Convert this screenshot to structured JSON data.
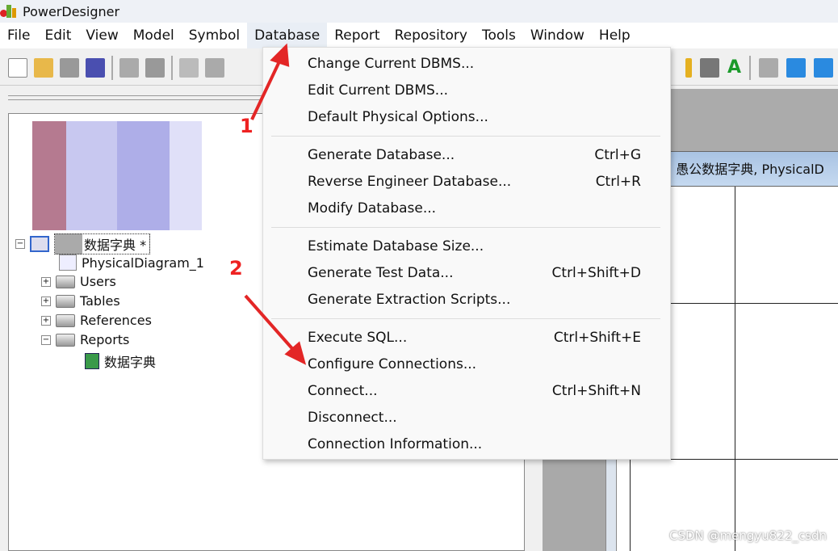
{
  "title": "PowerDesigner",
  "menubar": [
    "File",
    "Edit",
    "View",
    "Model",
    "Symbol",
    "Database",
    "Report",
    "Repository",
    "Tools",
    "Window",
    "Help"
  ],
  "active_menu": "Database",
  "dropdown": {
    "groups": [
      [
        {
          "label": "Change Current DBMS...",
          "shortcut": ""
        },
        {
          "label": "Edit Current DBMS...",
          "shortcut": ""
        },
        {
          "label": "Default Physical Options...",
          "shortcut": ""
        }
      ],
      [
        {
          "label": "Generate Database...",
          "shortcut": "Ctrl+G"
        },
        {
          "label": "Reverse Engineer Database...",
          "shortcut": "Ctrl+R"
        },
        {
          "label": "Modify Database...",
          "shortcut": ""
        }
      ],
      [
        {
          "label": "Estimate Database Size...",
          "shortcut": ""
        },
        {
          "label": "Generate Test Data...",
          "shortcut": "Ctrl+Shift+D"
        },
        {
          "label": "Generate Extraction Scripts...",
          "shortcut": ""
        }
      ],
      [
        {
          "label": "Execute SQL...",
          "shortcut": "Ctrl+Shift+E"
        },
        {
          "label": "Configure Connections...",
          "shortcut": ""
        },
        {
          "label": "Connect...",
          "shortcut": "Ctrl+Shift+N"
        },
        {
          "label": "Disconnect...",
          "shortcut": ""
        },
        {
          "label": "Connection Information...",
          "shortcut": ""
        }
      ]
    ]
  },
  "tree": {
    "model": "数据字典 *",
    "diagram": "PhysicalDiagram_1",
    "folders": [
      "Users",
      "Tables",
      "References",
      "Reports"
    ],
    "report": "数据字典"
  },
  "diagram_title": "1 愚公数据字典, PhysicalD",
  "annotations": {
    "step1": "1",
    "step2": "2",
    "color": "#e32626"
  },
  "watermark": "CSDN @mengyu822_csdn"
}
